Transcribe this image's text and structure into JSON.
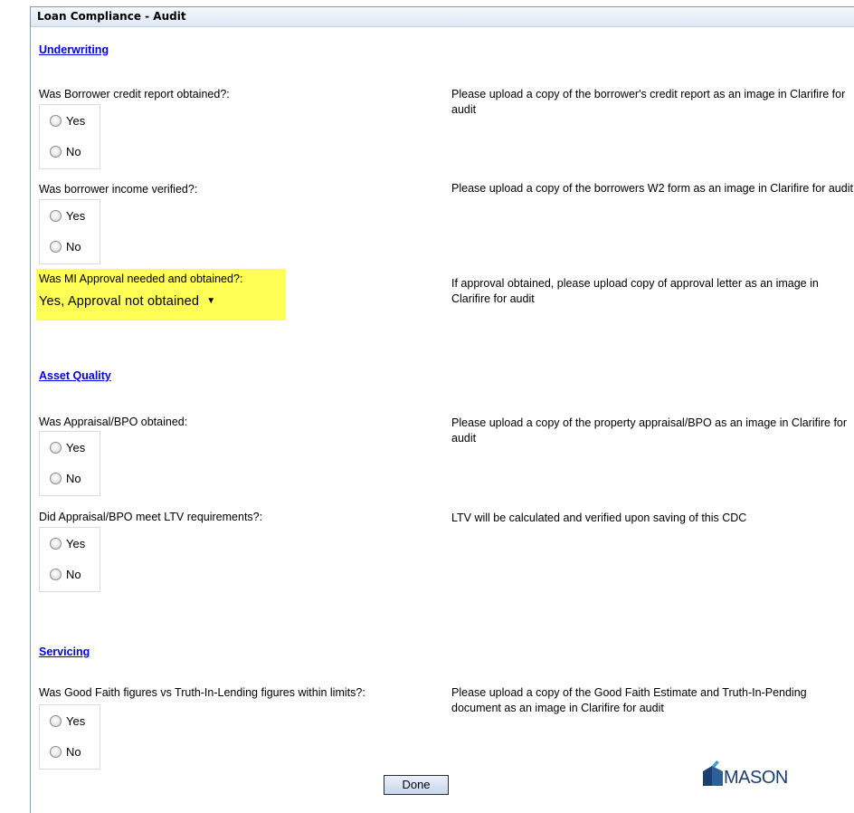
{
  "window": {
    "title": "Loan Compliance - Audit"
  },
  "sections": {
    "underwriting": "Underwriting",
    "asset_quality": "Asset Quality",
    "servicing": "Servicing"
  },
  "questions": [
    {
      "label": "Was Borrower credit report obtained?:",
      "note": "Please upload a copy of the borrower's credit report as an image in Clarifire for audit"
    },
    {
      "label": "Was borrower income verified?:",
      "note": "Please upload a copy of the borrowers W2 form as an image in Clarifire for audit"
    },
    {
      "label": "Was MI Approval needed and obtained?:",
      "note": "If approval obtained, please upload copy of approval letter as an image in Clarifire for audit",
      "selected": "Yes, Approval not obtained"
    },
    {
      "label": "Was Appraisal/BPO obtained:",
      "note": "Please upload a copy of the property appraisal/BPO as an image in Clarifire for audit"
    },
    {
      "label": "Did Appraisal/BPO meet LTV requirements?:",
      "note": "LTV will be calculated and verified upon saving of this CDC"
    },
    {
      "label": "Was Good Faith figures vs Truth-In-Lending figures within limits?:",
      "note": "Please upload a copy of the Good Faith Estimate and Truth-In-Pending document as an image in Clarifire for audit"
    }
  ],
  "options": {
    "yes": "Yes",
    "no": "No"
  },
  "done_button": "Done",
  "logo": {
    "text": "MASON",
    "icon": "mason-building-icon"
  },
  "colors": {
    "highlight": "#ffff55",
    "link": "#0000ee"
  }
}
